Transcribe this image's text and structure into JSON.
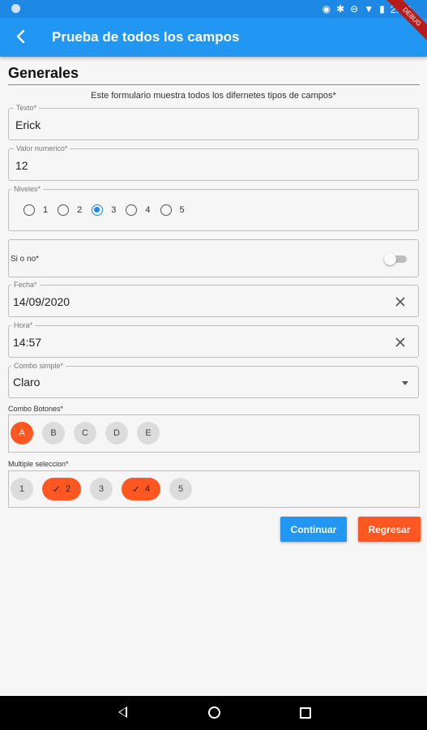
{
  "status_bar": {
    "time": "2:58",
    "icons": [
      "location-icon",
      "bluetooth-icon",
      "do-not-disturb-icon",
      "wifi-icon",
      "battery-icon"
    ],
    "color": "#1e88e5"
  },
  "debug_banner": "DEBUG",
  "app_bar": {
    "title": "Prueba de todos los campos",
    "back_icon": "arrow-back-icon",
    "color": "#2196f3"
  },
  "section": {
    "title": "Generales",
    "subtitle": "Este formulario muestra todos los difernetes tipos de campos*"
  },
  "fields": {
    "texto": {
      "label": "Texto*",
      "value": "Erick"
    },
    "numerico": {
      "label": "Valor numerico*",
      "value": "12"
    },
    "niveles": {
      "label": "Niveles*",
      "options": [
        "1",
        "2",
        "3",
        "4",
        "5"
      ],
      "selected": "3"
    },
    "si_no": {
      "label": "Si o no*",
      "value": false
    },
    "fecha": {
      "label": "Fecha*",
      "value": "14/09/2020"
    },
    "hora": {
      "label": "Hora*",
      "value": "14:57"
    },
    "combo_simple": {
      "label": "Combo simple*",
      "value": "Claro"
    }
  },
  "combo_botones": {
    "label": "Combo Botones*",
    "options": [
      "A",
      "B",
      "C",
      "D",
      "E"
    ],
    "selected": "A"
  },
  "multiple": {
    "label": "Multiple seleccion*",
    "options": [
      "1",
      "2",
      "3",
      "4",
      "5"
    ],
    "selected": [
      "2",
      "4"
    ]
  },
  "buttons": {
    "continue": "Continuar",
    "back": "Regresar"
  },
  "colors": {
    "accent": "#ff5722",
    "primary": "#2196f3"
  }
}
